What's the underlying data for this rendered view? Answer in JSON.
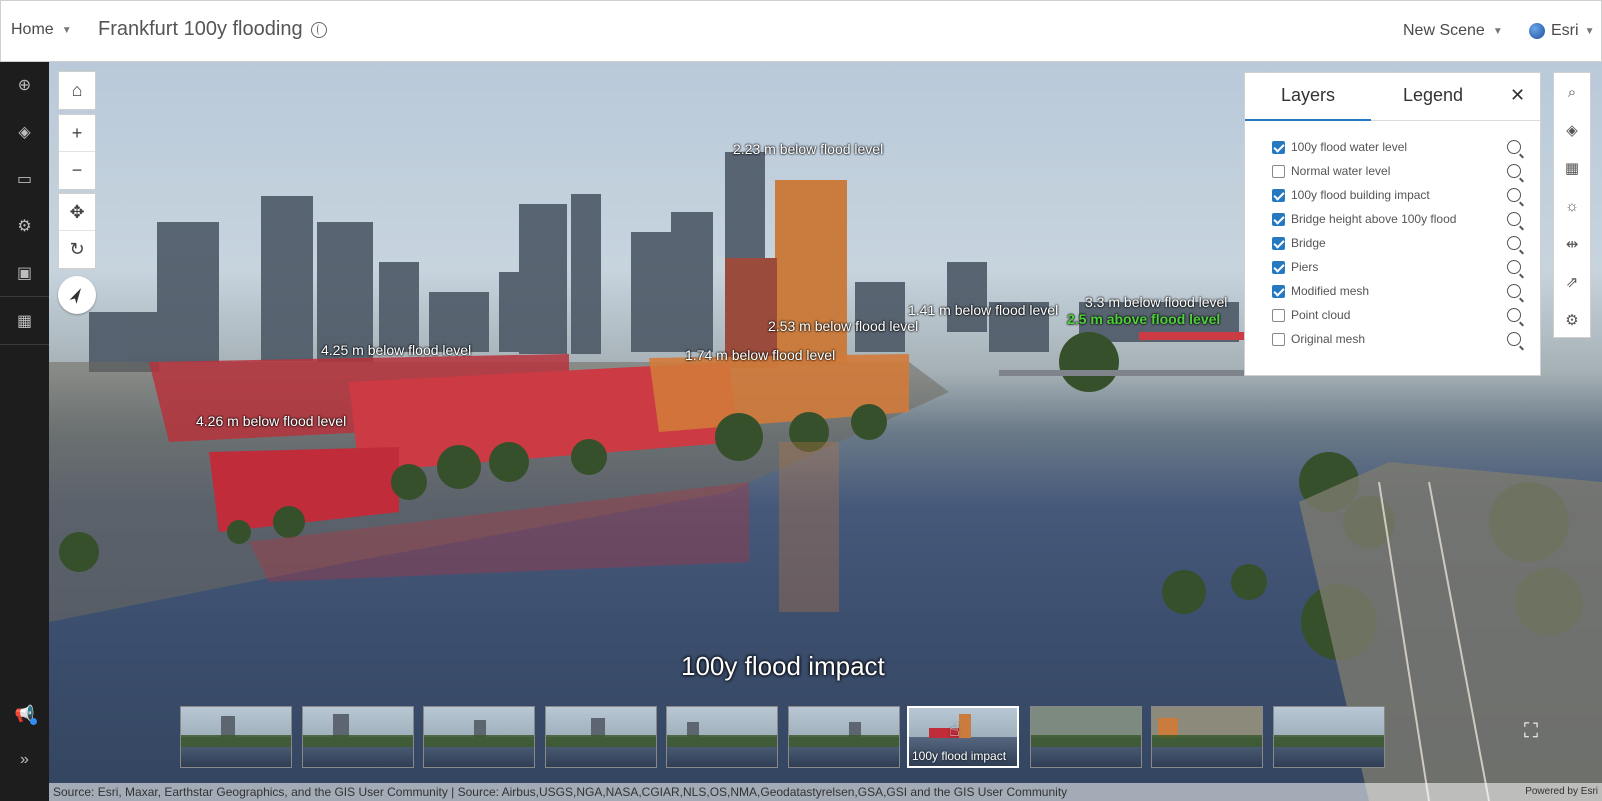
{
  "header": {
    "home_label": "Home",
    "scene_title": "Frankfurt 100y flooding",
    "new_scene_label": "New Scene",
    "user_label": "Esri"
  },
  "map_controls": {
    "home_icon": "home-icon",
    "zoom_in": "+",
    "zoom_out": "−",
    "pan_icon": "✥",
    "rotate_icon": "↻"
  },
  "flood_labels": [
    "2.23 m below flood level",
    "4.25 m below flood level",
    "4.26 m below flood level",
    "2.53 m below flood level",
    "1.74 m below flood level",
    "1.41 m below flood level",
    "3.3 m below flood level",
    "2.5 m above flood level"
  ],
  "slide": {
    "title": "100y flood impact",
    "active_caption": "100y flood impact",
    "count": 10,
    "active_index": 7
  },
  "panel": {
    "tab_layers": "Layers",
    "tab_legend": "Legend",
    "layers": [
      {
        "name": "100y flood water level",
        "checked": true
      },
      {
        "name": "Normal water level",
        "checked": false
      },
      {
        "name": "100y flood building impact",
        "checked": true
      },
      {
        "name": "Bridge height above 100y flood",
        "checked": true
      },
      {
        "name": "Bridge",
        "checked": true
      },
      {
        "name": "Piers",
        "checked": true
      },
      {
        "name": "Modified mesh",
        "checked": true
      },
      {
        "name": "Point cloud",
        "checked": false
      },
      {
        "name": "Original mesh",
        "checked": false
      }
    ]
  },
  "attribution": "Source: Esri, Maxar, Earthstar Geographics, and the GIS User Community | Source: Airbus,USGS,NGA,NASA,CGIAR,NLS,OS,NMA,Geodatastyrelsen,GSA,GSI and the GIS User Community",
  "powered_by": "Powered by Esri",
  "colors": {
    "accent": "#2679c1",
    "flood_red": "#c8303c",
    "flood_orange": "#d9873a",
    "above_green": "#4fd13c",
    "sidebar_bg": "#1d1d1d"
  }
}
